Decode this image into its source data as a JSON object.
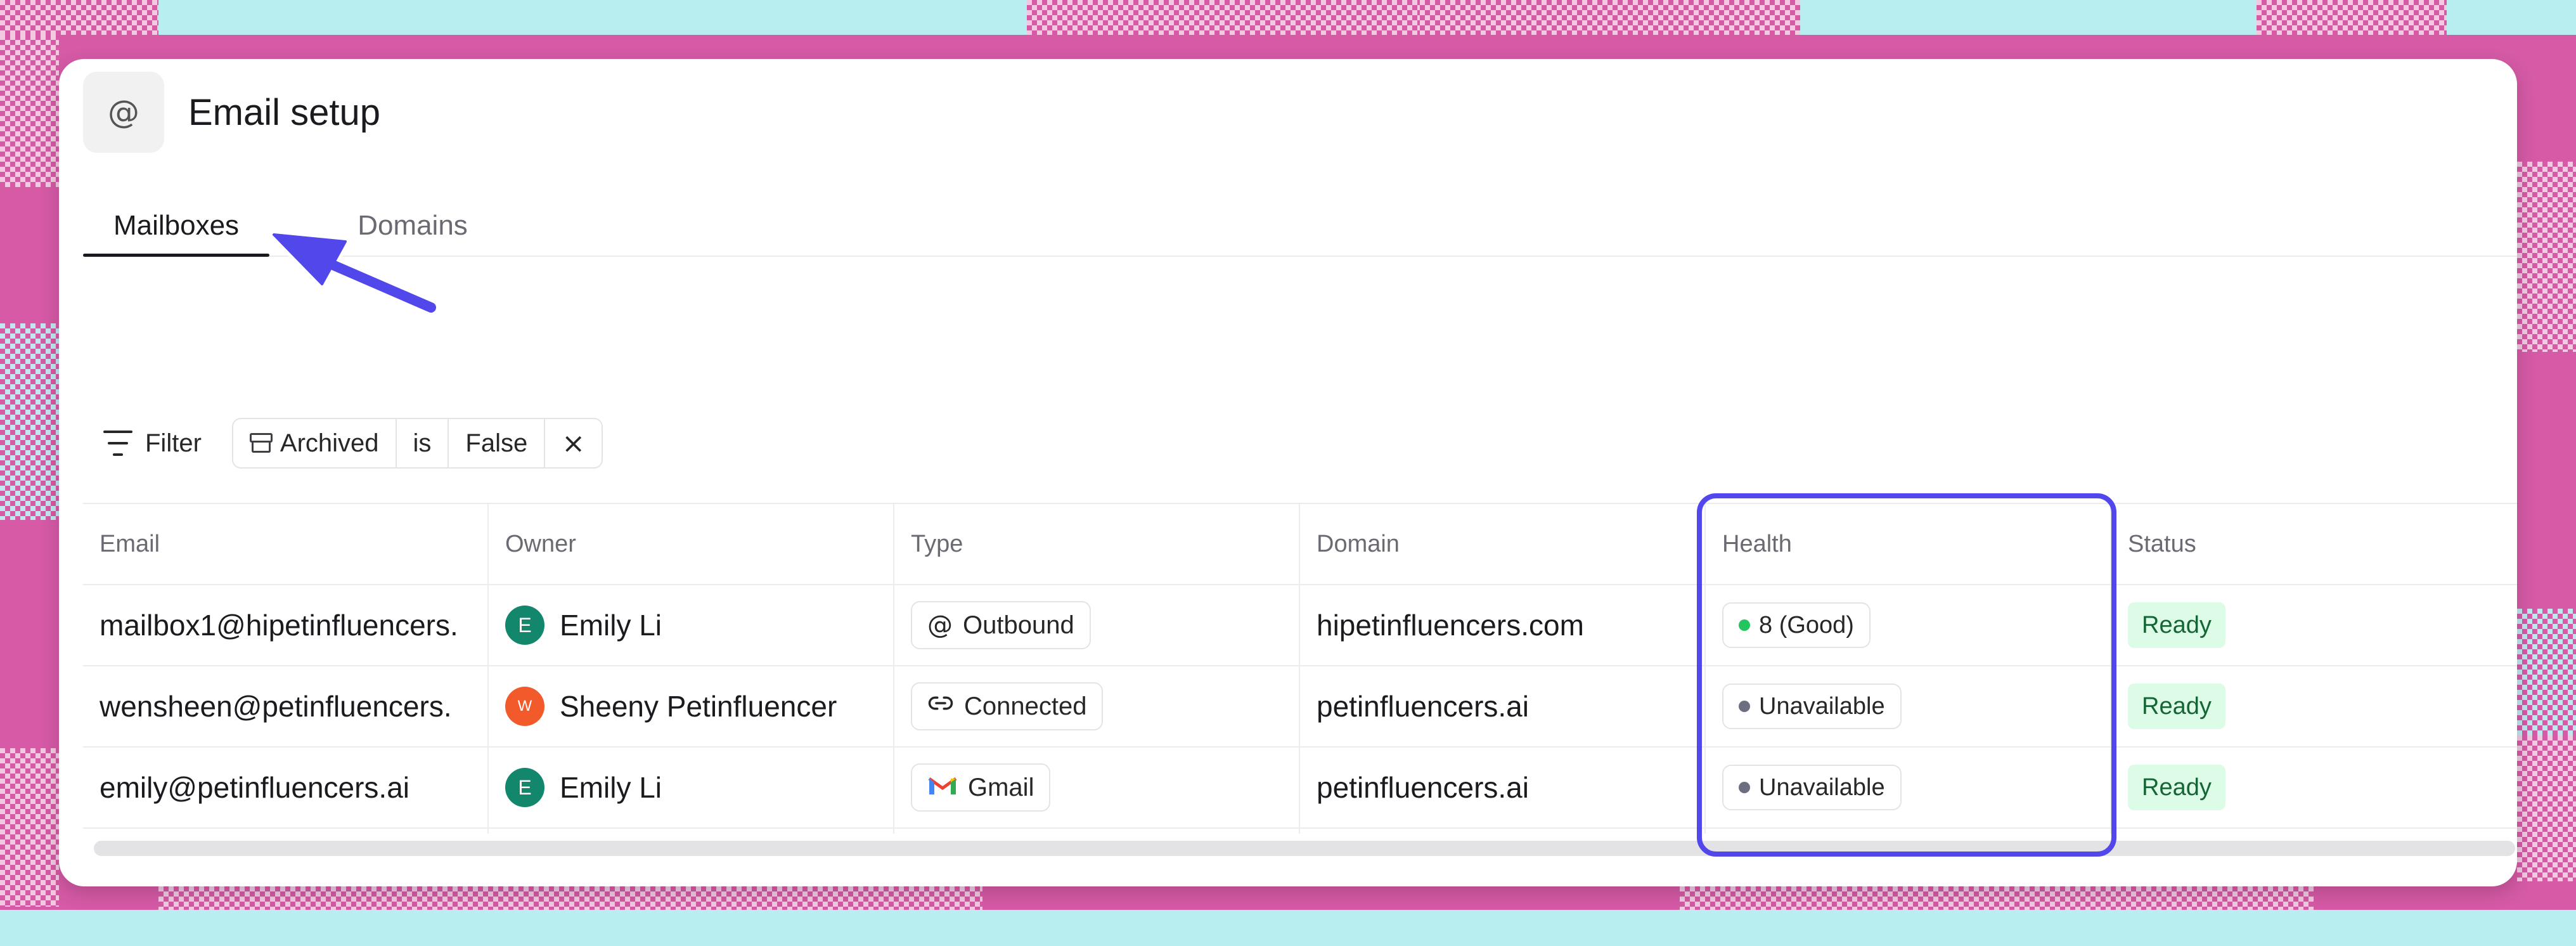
{
  "header": {
    "icon": "@",
    "title": "Email setup"
  },
  "tabs": [
    {
      "label": "Mailboxes"
    },
    {
      "label": "Domains"
    }
  ],
  "filter": {
    "button_label": "Filter",
    "chip": {
      "field": "Archived",
      "operator": "is",
      "value": "False",
      "remove_icon": "×"
    }
  },
  "table": {
    "columns": [
      "Email",
      "Owner",
      "Type",
      "Domain",
      "Health",
      "Status"
    ],
    "rows": [
      {
        "email": "mailbox1@hipetinfluencers.",
        "owner": {
          "initial": "E",
          "name": "Emily Li"
        },
        "type": {
          "icon": "@",
          "label": "Outbound"
        },
        "domain": "hipetinfluencers.com",
        "health": "8 (Good)",
        "status": "Ready"
      },
      {
        "email": "wensheen@petinfluencers.",
        "owner": {
          "initial": "W",
          "name": "Sheeny Petinfluencer"
        },
        "type": {
          "icon": "link",
          "label": "Connected"
        },
        "domain": "petinfluencers.ai",
        "health": "Unavailable",
        "status": "Ready"
      },
      {
        "email": "emily@petinfluencers.ai",
        "owner": {
          "initial": "E",
          "name": "Emily Li"
        },
        "type": {
          "icon": "gmail",
          "label": "Gmail"
        },
        "domain": "petinfluencers.ai",
        "health": "Unavailable",
        "status": "Ready"
      }
    ]
  },
  "colors": {
    "accent": "#5147ea",
    "avatar_teal": "#13876c",
    "avatar_orange": "#f25a2b",
    "health_good": "#22c55e",
    "health_unavailable": "#6b6f80",
    "ready_bg": "#dcfce7",
    "ready_text": "#166534"
  }
}
